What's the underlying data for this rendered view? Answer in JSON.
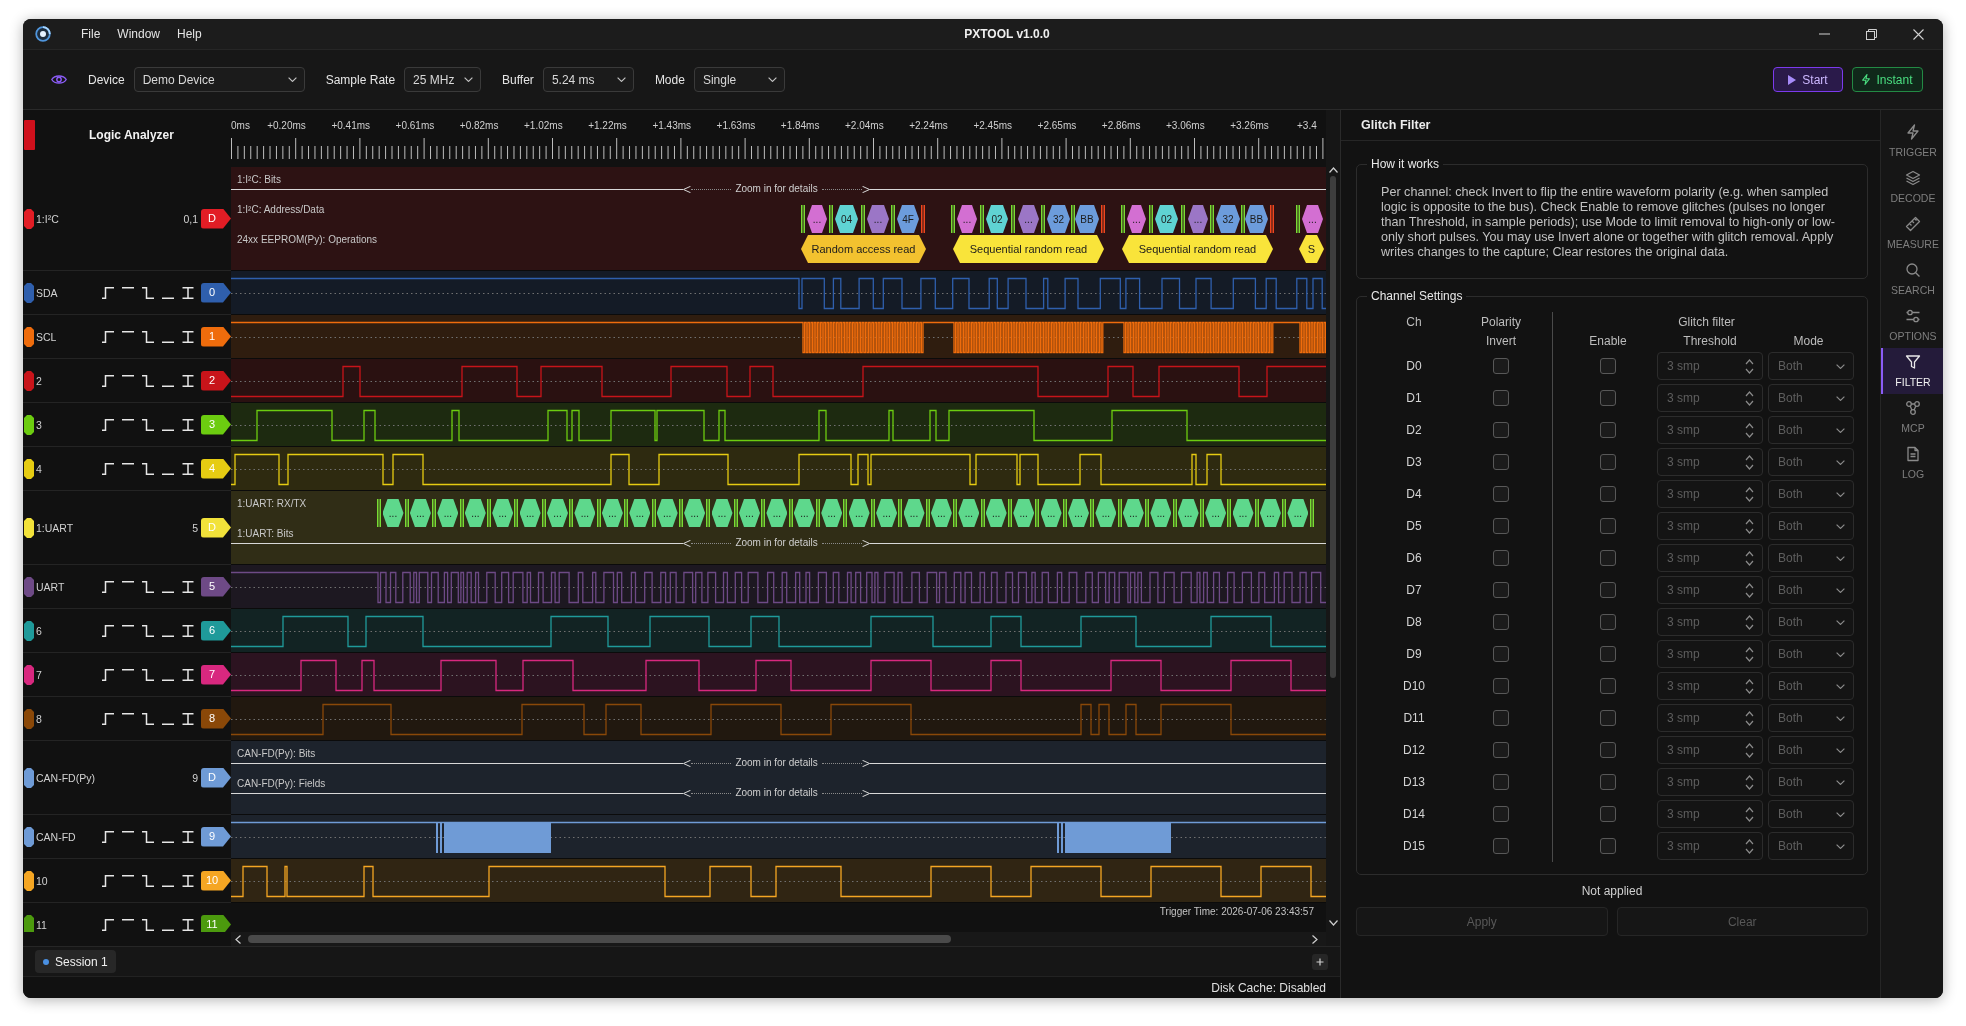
{
  "window": {
    "title": "PXTOOL v1.0.0",
    "menu": [
      "File",
      "Window",
      "Help"
    ]
  },
  "toolbar": {
    "fields": [
      {
        "label": "Device",
        "value": "Demo Device"
      },
      {
        "label": "Sample Rate",
        "value": "25 MHz"
      },
      {
        "label": "Buffer",
        "value": "5.24 ms"
      },
      {
        "label": "Mode",
        "value": "Single"
      }
    ],
    "buttons": [
      {
        "kind": "start",
        "label": "Start"
      },
      {
        "kind": "instant",
        "label": "Instant"
      }
    ]
  },
  "analyzer": {
    "title": "Logic Analyzer",
    "time_ticks": [
      "0ms",
      "+0.20ms",
      "+0.41ms",
      "+0.61ms",
      "+0.82ms",
      "+1.02ms",
      "+1.22ms",
      "+1.43ms",
      "+1.63ms",
      "+1.84ms",
      "+2.04ms",
      "+2.24ms",
      "+2.45ms",
      "+2.65ms",
      "+2.86ms",
      "+3.06ms",
      "+3.26ms",
      "+3.4"
    ],
    "rows": [
      {
        "kind": "decoder",
        "name": "1:I²C",
        "channels": "0,1",
        "tag": "D",
        "color": "#e21d25",
        "tracks": [
          {
            "kind": "range",
            "title": "1:I²C: Bits",
            "note": "Zoom in for details"
          },
          {
            "kind": "segments",
            "title": "1:I²C: Address/Data",
            "segments": [
              {
                "label": "...",
                "color": "#d36fd2"
              },
              {
                "label": "04",
                "color": "#5fd3d3"
              },
              {
                "label": "...",
                "color": "#9b76c6"
              },
              {
                "label": "4F",
                "color": "#6c9cdc"
              },
              {
                "label": "...",
                "color": "#d36fd2"
              },
              {
                "label": "02",
                "color": "#5fd3d3"
              },
              {
                "label": "...",
                "color": "#9b76c6"
              },
              {
                "label": "32",
                "color": "#6c9cdc"
              },
              {
                "label": "BB",
                "color": "#6c9cdc"
              },
              {
                "label": "...",
                "color": "#d36fd2"
              },
              {
                "label": "02",
                "color": "#5fd3d3"
              },
              {
                "label": "...",
                "color": "#9b76c6"
              },
              {
                "label": "32",
                "color": "#6c9cdc"
              },
              {
                "label": "BB",
                "color": "#6c9cdc"
              },
              {
                "label": "...",
                "color": "#d36fd2"
              }
            ]
          },
          {
            "kind": "operations",
            "title": "24xx EEPROM(Py): Operations",
            "segments": [
              {
                "label": "Random access read",
                "color": "#f3c22f"
              },
              {
                "label": "Sequential random read",
                "color": "#f9e43a"
              },
              {
                "label": "Sequential random read",
                "color": "#f9e43a"
              },
              {
                "label": "S",
                "color": "#f9e43a"
              }
            ]
          }
        ]
      },
      {
        "kind": "channel",
        "name": "SDA",
        "tag": "0",
        "color": "#2f5fad"
      },
      {
        "kind": "channel",
        "name": "SCL",
        "tag": "1",
        "color": "#ef6c0c"
      },
      {
        "kind": "channel",
        "name": "2",
        "tag": "2",
        "color": "#c8141a"
      },
      {
        "kind": "channel",
        "name": "3",
        "tag": "3",
        "color": "#6ccc10"
      },
      {
        "kind": "channel",
        "name": "4",
        "tag": "4",
        "color": "#e6cc12"
      },
      {
        "kind": "decoder",
        "name": "1:UART",
        "channels": "5",
        "tag": "D",
        "color": "#f2e23a",
        "tracks": [
          {
            "kind": "segments",
            "title": "1:UART: RX/TX",
            "segments": [
              {
                "label": "..."
              },
              {
                "label": "..."
              },
              {
                "label": "..."
              },
              {
                "label": "..."
              },
              {
                "label": "..."
              },
              {
                "label": "..."
              },
              {
                "label": "..."
              },
              {
                "label": "..."
              },
              {
                "label": "..."
              },
              {
                "label": "..."
              },
              {
                "label": "..."
              },
              {
                "label": "..."
              },
              {
                "label": "..."
              },
              {
                "label": "..."
              },
              {
                "label": "..."
              },
              {
                "label": "..."
              },
              {
                "label": "..."
              },
              {
                "label": "..."
              },
              {
                "label": "..."
              },
              {
                "label": "..."
              },
              {
                "label": "..."
              },
              {
                "label": "..."
              },
              {
                "label": "..."
              },
              {
                "label": "..."
              },
              {
                "label": "..."
              },
              {
                "label": "..."
              },
              {
                "label": "..."
              },
              {
                "label": "..."
              },
              {
                "label": "..."
              },
              {
                "label": "..."
              },
              {
                "label": "..."
              },
              {
                "label": "..."
              },
              {
                "label": "..."
              },
              {
                "label": "..."
              }
            ]
          },
          {
            "kind": "range",
            "title": "1:UART: Bits",
            "note": "Zoom in for details"
          }
        ]
      },
      {
        "kind": "channel",
        "name": "UART",
        "tag": "5",
        "color": "#6e4a86"
      },
      {
        "kind": "channel",
        "name": "6",
        "tag": "6",
        "color": "#1f9a9a"
      },
      {
        "kind": "channel",
        "name": "7",
        "tag": "7",
        "color": "#d8287f"
      },
      {
        "kind": "channel",
        "name": "8",
        "tag": "8",
        "color": "#8a4808"
      },
      {
        "kind": "decoder",
        "name": "CAN-FD(Py)",
        "channels": "9",
        "tag": "D",
        "color": "#6f9bd6",
        "tracks": [
          {
            "kind": "range",
            "title": "CAN-FD(Py): Bits",
            "note": "Zoom in for details"
          },
          {
            "kind": "range",
            "title": "CAN-FD(Py): Fields",
            "note": "Zoom in for details"
          }
        ]
      },
      {
        "kind": "channel",
        "name": "CAN-FD",
        "tag": "9",
        "color": "#6f9bd6"
      },
      {
        "kind": "channel",
        "name": "10",
        "tag": "10",
        "color": "#f5a623"
      },
      {
        "kind": "channel",
        "name": "11",
        "tag": "11",
        "color": "#4c9a0e"
      }
    ]
  },
  "trigger_time": "Trigger Time: 2026-07-06 23:43:57",
  "sessions": [
    {
      "label": "Session 1",
      "selected": true
    }
  ],
  "status_bar": {
    "text": "Disk Cache: Disabled"
  },
  "glitch_filter": {
    "title": "Glitch Filter",
    "info": {
      "title": "How it works",
      "text": "Per channel: check Invert to flip the entire waveform polarity (e.g. when sampled logic is opposite to the bus). Check Enable to remove glitches (pulses no longer than Threshold, in sample periods); use Mode to limit removal to high-only or low-only short pulses. You may use Invert alone or together with glitch removal. Apply writes changes to the capture; Clear restores the original data."
    },
    "settings": {
      "title": "Channel Settings",
      "ch_header": "Ch",
      "groups": [
        {
          "label": "Polarity",
          "columns": [
            "Invert"
          ]
        },
        {
          "label": "Glitch filter",
          "columns": [
            "Enable",
            "Threshold",
            "Mode"
          ]
        }
      ],
      "rows": [
        {
          "ch": "D0",
          "invert": false,
          "enable": false,
          "threshold": "3 smp",
          "mode": "Both"
        },
        {
          "ch": "D1",
          "invert": false,
          "enable": false,
          "threshold": "3 smp",
          "mode": "Both"
        },
        {
          "ch": "D2",
          "invert": false,
          "enable": false,
          "threshold": "3 smp",
          "mode": "Both"
        },
        {
          "ch": "D3",
          "invert": false,
          "enable": false,
          "threshold": "3 smp",
          "mode": "Both"
        },
        {
          "ch": "D4",
          "invert": false,
          "enable": false,
          "threshold": "3 smp",
          "mode": "Both"
        },
        {
          "ch": "D5",
          "invert": false,
          "enable": false,
          "threshold": "3 smp",
          "mode": "Both"
        },
        {
          "ch": "D6",
          "invert": false,
          "enable": false,
          "threshold": "3 smp",
          "mode": "Both"
        },
        {
          "ch": "D7",
          "invert": false,
          "enable": false,
          "threshold": "3 smp",
          "mode": "Both"
        },
        {
          "ch": "D8",
          "invert": false,
          "enable": false,
          "threshold": "3 smp",
          "mode": "Both"
        },
        {
          "ch": "D9",
          "invert": false,
          "enable": false,
          "threshold": "3 smp",
          "mode": "Both"
        },
        {
          "ch": "D10",
          "invert": false,
          "enable": false,
          "threshold": "3 smp",
          "mode": "Both"
        },
        {
          "ch": "D11",
          "invert": false,
          "enable": false,
          "threshold": "3 smp",
          "mode": "Both"
        },
        {
          "ch": "D12",
          "invert": false,
          "enable": false,
          "threshold": "3 smp",
          "mode": "Both"
        },
        {
          "ch": "D13",
          "invert": false,
          "enable": false,
          "threshold": "3 smp",
          "mode": "Both"
        },
        {
          "ch": "D14",
          "invert": false,
          "enable": false,
          "threshold": "3 smp",
          "mode": "Both"
        },
        {
          "ch": "D15",
          "invert": false,
          "enable": false,
          "threshold": "3 smp",
          "mode": "Both"
        }
      ]
    },
    "status": "Not applied",
    "buttons": [
      {
        "label": "Apply",
        "disabled": true
      },
      {
        "label": "Clear",
        "disabled": true
      }
    ]
  },
  "side_tabs": [
    {
      "label": "TRIGGER",
      "selected": false
    },
    {
      "label": "DECODE",
      "selected": false
    },
    {
      "label": "MEASURE",
      "selected": false
    },
    {
      "label": "SEARCH",
      "selected": false
    },
    {
      "label": "OPTIONS",
      "selected": false
    },
    {
      "label": "FILTER",
      "selected": true
    },
    {
      "label": "MCP",
      "selected": false
    },
    {
      "label": "LOG",
      "selected": false
    }
  ]
}
